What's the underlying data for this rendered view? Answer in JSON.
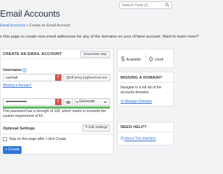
{
  "search": {
    "placeholder": "Search Tools (/)"
  },
  "page": {
    "title": "Email Accounts",
    "breadcrumb": {
      "parent": "Email Accounts",
      "separator": "»",
      "current": "Create an Email Account"
    },
    "intro": "e this page to create new email addresses for any of the domains on your cPanel account. Want to learn more?"
  },
  "form": {
    "heading": "CREATE AN EMAIL ACCOUNT",
    "help_button": "Show/Hide Help",
    "username_label": "Username",
    "username_value": "suemail",
    "domain_value": "@kff.wmq.myjbluehost.me",
    "missing_domain_link": "Missing a domain?",
    "password_value": "••••••••••••••••••••",
    "generate_label": "Generate",
    "strength_fraction": 1.0,
    "password_message": "This password has a strength of 100, which meets or exceeds the system requirement of 65.",
    "optional_settings_label": "Optional Settings",
    "edit_settings_label": "Edit Settings",
    "stay_label": "Stay on this page after I click Create.",
    "create_label": "+ Create",
    "error_badge": "!"
  },
  "stats": {
    "available_count": "5",
    "available_label": "Available",
    "used_count": "0",
    "used_label": "Used"
  },
  "missing_panel": {
    "title": "MISSING A DOMAIN?",
    "text": "Navigate to a full list of the accounts domains.",
    "link": "Manage Domains"
  },
  "help_panel": {
    "title": "NEED HELP?",
    "link": "About This Interface"
  },
  "colors": {
    "primary": "#2c75d6",
    "error": "#d9534f",
    "strength": "#5cb85c",
    "link": "#2e6fd8"
  }
}
